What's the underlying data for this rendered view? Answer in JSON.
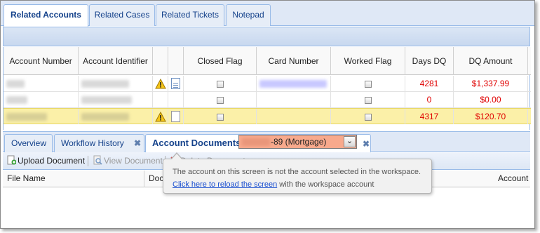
{
  "top_tabs": [
    "Related Accounts",
    "Related Cases",
    "Related Tickets",
    "Notepad"
  ],
  "columns": {
    "account_number": "Account Number",
    "account_identifier": "Account Identifier",
    "closed_flag": "Closed Flag",
    "card_number": "Card Number",
    "worked_flag": "Worked Flag",
    "days_dq": "Days DQ",
    "dq_amount": "DQ Amount"
  },
  "rows": [
    {
      "days_dq": "4281",
      "dq_amount": "$1,337.99",
      "warning": true,
      "doc_icon": "document-icon"
    },
    {
      "days_dq": "0",
      "dq_amount": "$0.00",
      "warning": false,
      "doc_icon": ""
    },
    {
      "days_dq": "4317",
      "dq_amount": "$120.70",
      "warning": true,
      "doc_icon": "blank-document-icon",
      "selected": true
    }
  ],
  "bottom_tabs": [
    "Overview",
    "Workflow History",
    "Account Documents"
  ],
  "account_combo": {
    "value": "-89 (Mortgage)",
    "color": "#f8a98c"
  },
  "doc_toolbar": {
    "upload": "Upload Document",
    "view": "View Document",
    "delete": "Delete Document"
  },
  "doc_columns": {
    "file_name": "File Name",
    "doc": "Doc",
    "account": "Account"
  },
  "tooltip": {
    "message": "The account on this screen is not the account selected in the workspace.",
    "link_text": "Click here to reload the screen",
    "trailing_text": " with the workspace account"
  }
}
